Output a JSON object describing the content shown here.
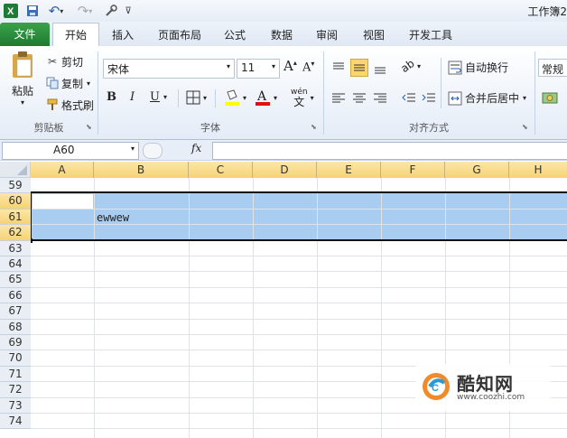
{
  "title_bar": {
    "app_title": "工作簿2",
    "qat": [
      "save",
      "undo",
      "redo",
      "customize"
    ]
  },
  "tabs": [
    "文件",
    "开始",
    "插入",
    "页面布局",
    "公式",
    "数据",
    "审阅",
    "视图",
    "开发工具"
  ],
  "clipboard": {
    "paste": "粘贴",
    "cut": "剪切",
    "copy": "复制",
    "format_painter": "格式刷",
    "group": "剪贴板"
  },
  "font": {
    "name": "宋体",
    "size": "11",
    "group": "字体",
    "bold": "B",
    "italic": "I",
    "underline": "U",
    "wen": "wén"
  },
  "alignment": {
    "wrap": "自动换行",
    "merge": "合并后居中",
    "group": "对齐方式"
  },
  "number": {
    "format": "常规"
  },
  "formula_bar": {
    "name_box": "A60",
    "fx": "fx",
    "content": ""
  },
  "columns": [
    "A",
    "B",
    "C",
    "D",
    "E",
    "F",
    "G",
    "H"
  ],
  "rows": [
    "59",
    "60",
    "61",
    "62",
    "63",
    "64",
    "65",
    "66",
    "67",
    "68",
    "69",
    "70",
    "71",
    "72",
    "73",
    "74"
  ],
  "selected_rows": [
    "60",
    "61",
    "62"
  ],
  "cells": {
    "B61": "ewwew"
  },
  "watermark": {
    "name": "酷知网",
    "url": "www.coozhi.com"
  },
  "colors": {
    "file_tab": "#2a8a3a",
    "selection": "#a9cdf0",
    "header_selected": "#f6d275"
  }
}
